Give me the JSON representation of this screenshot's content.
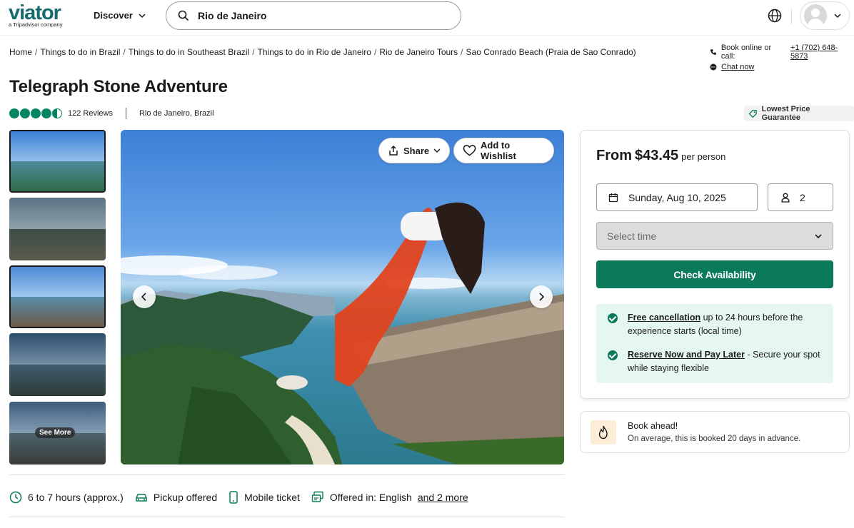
{
  "header": {
    "logo_text": "viator",
    "logo_sub": "a Tripadvisor company",
    "discover_label": "Discover",
    "search_value": "Rio de Janeiro"
  },
  "breadcrumb": [
    "Home",
    "Things to do in Brazil",
    "Things to do in Southeast Brazil",
    "Things to do in Rio de Janeiro",
    "Rio de Janeiro Tours",
    "Sao Conrado Beach (Praia de Sao Conrado)"
  ],
  "contact": {
    "book_label": "Book online or call:",
    "phone": "+1 (702) 648-5873",
    "chat_label": "Chat now"
  },
  "product": {
    "title": "Telegraph Stone Adventure",
    "rating": 4.5,
    "reviews_label": "122 Reviews",
    "location": "Rio de Janeiro, Brazil",
    "lowest_price_label": "Lowest Price Guarantee"
  },
  "gallery": {
    "see_more_label": "See More",
    "share_label": "Share",
    "wishlist_label": "Add to Wishlist",
    "selected_thumb_index": 0
  },
  "booking": {
    "from_label": "From",
    "price": "$43.45",
    "per_label": "per person",
    "date_value": "Sunday, Aug 10, 2025",
    "travelers": "2",
    "time_placeholder": "Select time",
    "check_label": "Check Availability",
    "benefits": [
      {
        "title": "Free cancellation",
        "text": " up to 24 hours before the experience starts (local time)"
      },
      {
        "title": "Reserve Now and Pay Later",
        "text": " - Secure your spot while staying flexible"
      }
    ]
  },
  "book_ahead": {
    "title": "Book ahead!",
    "text": "On average, this is booked 20 days in advance."
  },
  "features": {
    "duration": "6 to 7 hours (approx.)",
    "pickup": "Pickup offered",
    "ticket": "Mobile ticket",
    "language_prefix": "Offered in: English",
    "language_more": "and 2 more"
  },
  "colors": {
    "brand": "#186b6d",
    "accent": "#0b7a5a",
    "star": "#058562",
    "benefit_bg": "#e6f6f1"
  }
}
